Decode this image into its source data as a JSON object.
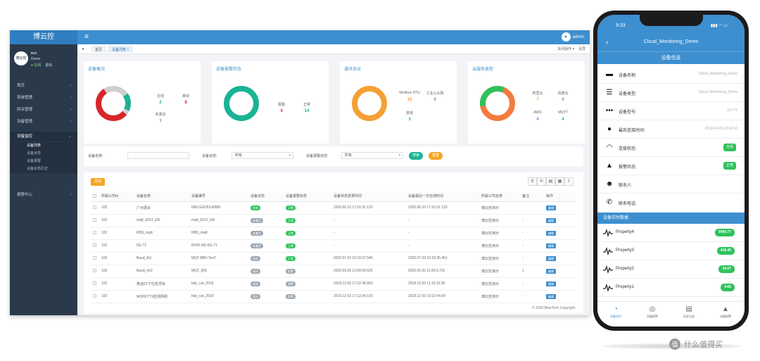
{
  "desktop": {
    "brand": "博云控",
    "user_name": "admin",
    "profile": {
      "avatar_text": "博云控",
      "name": "test",
      "org": "Demo",
      "status": "● 在线",
      "logout": "退出"
    },
    "nav": [
      {
        "label": "首页",
        "chev": "‹"
      },
      {
        "label": "系统管理",
        "chev": "‹"
      },
      {
        "label": "网关管理",
        "chev": "‹"
      },
      {
        "label": "设备管理",
        "chev": "‹"
      },
      {
        "label": "设备监控",
        "chev": "⌄"
      },
      {
        "label": "报警中心",
        "chev": "‹"
      }
    ],
    "nav_sub": [
      "设备列表",
      "设备状态",
      "设备报警",
      "设备状态历史"
    ],
    "tabs": {
      "back": "◂",
      "home": "首页",
      "monitor": "设备列表 ×",
      "r1": "关闭操作 ▾",
      "r2": "全屏"
    },
    "cards": [
      {
        "title": "设备概况",
        "stats": [
          {
            "label": "在线",
            "value": "2"
          },
          {
            "label": "离线",
            "value": "8"
          },
          {
            "label": "未激活",
            "value": "1"
          }
        ]
      },
      {
        "title": "设备报警状态",
        "stats": [
          {
            "label": "报警",
            "value": "4"
          },
          {
            "label": "正常",
            "value": "14"
          }
        ]
      },
      {
        "title": "通讯协议",
        "stats": [
          {
            "label": "Modbus RTU",
            "value": "15"
          },
          {
            "label": "工业以太网",
            "value": "0"
          },
          {
            "label": "其他",
            "value": "3"
          }
        ]
      },
      {
        "title": "云服务类型",
        "stats": [
          {
            "label": "阿里云",
            "value": "7"
          },
          {
            "label": "百度云",
            "value": "0"
          },
          {
            "label": "AWS",
            "value": "4"
          },
          {
            "label": "MQTT",
            "value": "4"
          }
        ]
      }
    ],
    "filters": {
      "name_label": "设备名称:",
      "status_label": "设备状态:",
      "status_value": "所有",
      "alarm_label": "设备报警状态:",
      "alarm_value": "所有",
      "search": "搜索",
      "reset": "重置"
    },
    "table": {
      "add": "添加",
      "tools": [
        "⚲",
        "↻",
        "▤",
        "▦",
        "⇩"
      ],
      "headers": [
        "",
        "所属公司id",
        "设备名称",
        "设备编号",
        "设备状态",
        "设备报警状态",
        "设备状态变更时间",
        "设备最后一次在线时间",
        "所属公司名称",
        "备注",
        "操作"
      ],
      "rows": [
        [
          "102",
          "广州展会",
          "6WLGGD53-EB80",
          "在线",
          "正常",
          "2020.06.10 17:10:31 125",
          "2020.06.10 17:10:31 125",
          "博云控演示",
          "",
          "编辑"
        ],
        [
          "102",
          "mqtt_0012_EB",
          "mqtt_0012_EB",
          "未激活",
          "正常",
          "-",
          "-",
          "博云控演示",
          "-",
          "编辑"
        ],
        [
          "102",
          "RBS_mqtt",
          "RBS_mqtt",
          "未激活",
          "正常",
          "-",
          "-",
          "博云控演示",
          "-",
          "编辑"
        ],
        [
          "102",
          "5G-71",
          "6F4D-ND-5G-71",
          "未激活",
          "正常",
          "-",
          "-",
          "博云控演示",
          "-",
          "编辑"
        ],
        [
          "102",
          "Baud_tb1",
          "MQT-BBS-TesT",
          "离线",
          "正常",
          "2020.07.03 10:18:37.545",
          "2020.07.03 10:18:35.451",
          "博云控演示",
          "-",
          "编辑"
        ],
        [
          "102",
          "Baud_tm2",
          "MQT_IBS",
          "离线",
          "报警",
          "2020.03.20 12:09:50.525",
          "2020.03.20 11:42:5.731",
          "博云控演示",
          "1",
          "编辑"
        ],
        [
          "102",
          "奥迪Z2下位机项目",
          "bdy_cat_2019",
          "离线",
          "报警",
          "2019.12.03 17:22:36.893",
          "2019.12.03 11:16:12.00",
          "博云控演示",
          "-",
          "编辑"
        ],
        [
          "102",
          "MOPETTS检测网络",
          "bdy_cat_2019",
          "离线",
          "报警",
          "2019.12.03 17:12:34.193",
          "2019.12.03 10:12:04.00",
          "博云控演示",
          "-",
          "编辑"
        ]
      ]
    },
    "copyright": "© 2020 BlueTech Copyright"
  },
  "phone": {
    "time": "9:33",
    "signal": "▮▮▮ ◠ ▭",
    "back": "‹",
    "title": "Cloud_Monitoring_Demo",
    "section_info": "设备信息",
    "info_rows": [
      {
        "icon": "▬",
        "label": "设备名称:",
        "value": "Cloud_Monitoring_Demo"
      },
      {
        "icon": "☰",
        "label": "设备类型:",
        "value": "Cloud_Monitoring_Demo"
      },
      {
        "icon": "•••",
        "label": "设备型号:",
        "value": "XX-YY"
      },
      {
        "icon": "●",
        "label": "最后连接时间:",
        "value": "2019-04-09 12:44:10"
      },
      {
        "icon": "◠",
        "label": "连接状态:",
        "pill": "在线"
      },
      {
        "icon": "▲",
        "label": "报警状态:",
        "pill": "正常"
      },
      {
        "icon": "☻",
        "label": "联系人:",
        "value": ""
      },
      {
        "icon": "✆",
        "label": "联系电话:",
        "value": ""
      }
    ],
    "section_realtime": "设备实时数据",
    "properties": [
      {
        "label": "Property4",
        "value": "9999.77"
      },
      {
        "label": "Property3",
        "value": "418.40"
      },
      {
        "label": "Property2",
        "value": "33.67"
      },
      {
        "label": "Property1",
        "value": "4.65"
      }
    ],
    "tabs": [
      {
        "icon": "◔",
        "label": "设备实时"
      },
      {
        "icon": "◎",
        "label": "设备报警"
      },
      {
        "icon": "▤",
        "label": "历史记录"
      },
      {
        "icon": "▲",
        "label": "设备报警"
      }
    ]
  },
  "watermark": {
    "text": "值 什么值得买"
  },
  "colors": {
    "accent": "#3d8fcf",
    "online": "#2ec25b",
    "sidebar": "#2b3a4a",
    "teal": "#1ab394",
    "red": "#d9262c",
    "orange": "#f5a035"
  }
}
